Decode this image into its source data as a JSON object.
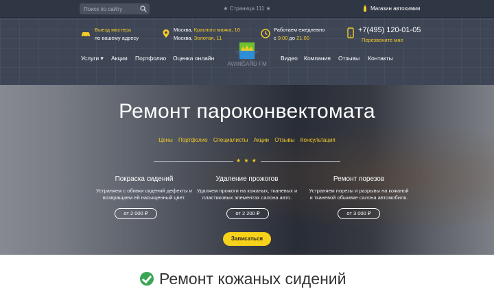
{
  "topbar": {
    "search_placeholder": "Поиск по сайту",
    "page_label": "★ Страница 111 ★",
    "shop_link": "Магазин автохимии"
  },
  "contacts": {
    "visit_line1": "Выезд мастера",
    "visit_line2": "по вашему адресу",
    "address_prefix1": "Москва, ",
    "address_street1": "Красного маяка, 16",
    "address_prefix2": "Москва, ",
    "address_street2": "Золотая, 11",
    "hours_line1": "Работаем ежедневно",
    "hours_prefix": "с ",
    "hours_from": "9:00",
    "hours_mid": " до ",
    "hours_to": "21:00",
    "phone": "+7(495) 120-01-05",
    "callback": "Перезвоните мне"
  },
  "nav": {
    "services": "Услуги ▾",
    "promo": "Акции",
    "portfolio": "Портфолио",
    "rate": "Оценка онлайн",
    "video": "Видео",
    "company": "Компания",
    "reviews": "Отзывы",
    "contacts": "Контакты"
  },
  "logo": {
    "text": "AVANGARD FM"
  },
  "hero": {
    "title": "Ремонт пароконвектомата",
    "sublinks": [
      "Цены",
      "Портфолио",
      "Специалисты",
      "Акции",
      "Отзывы",
      "Консультация"
    ],
    "stars": "★ ★ ★",
    "services": [
      {
        "title": "Покраска сидений",
        "desc1": "Устраняем с обивки сидений дефекты и",
        "desc2": "возвращаем ей насыщенный цвет.",
        "price": "от 2 000 ₽"
      },
      {
        "title": "Удаление прожогов",
        "desc1": "Удаляем прожоги на кожаных, тканевых и",
        "desc2": "пластиковых элементах салона авто.",
        "price": "от 2 200 ₽"
      },
      {
        "title": "Ремонт порезов",
        "desc1": "Устраняем порезы и разрывы на кожаной",
        "desc2": "и тканевой обшивке салона автомобиля.",
        "price": "от 3 000 ₽"
      }
    ],
    "cta": "Записаться"
  },
  "section": {
    "title": "Ремонт кожаных сидений"
  },
  "colors": {
    "accent": "#f4cc27",
    "header_bg": "#3e4656",
    "check": "#3aa655"
  }
}
